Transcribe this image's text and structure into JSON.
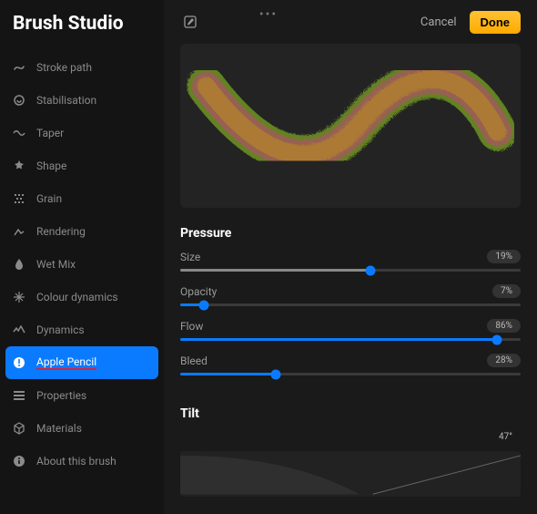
{
  "app_title": "Brush Studio",
  "topbar": {
    "cancel_label": "Cancel",
    "done_label": "Done"
  },
  "sidebar": {
    "items": [
      {
        "label": "Stroke path"
      },
      {
        "label": "Stabilisation"
      },
      {
        "label": "Taper"
      },
      {
        "label": "Shape"
      },
      {
        "label": "Grain"
      },
      {
        "label": "Rendering"
      },
      {
        "label": "Wet Mix"
      },
      {
        "label": "Colour dynamics"
      },
      {
        "label": "Dynamics"
      },
      {
        "label": "Apple Pencil"
      },
      {
        "label": "Properties"
      },
      {
        "label": "Materials"
      },
      {
        "label": "About this brush"
      }
    ]
  },
  "sections": {
    "pressure_title": "Pressure",
    "tilt_title": "Tilt"
  },
  "pressure": {
    "size": {
      "label": "Size",
      "value_text": "19%",
      "percent": 56
    },
    "opacity": {
      "label": "Opacity",
      "value_text": "7%",
      "percent": 7
    },
    "flow": {
      "label": "Flow",
      "value_text": "86%",
      "percent": 93
    },
    "bleed": {
      "label": "Bleed",
      "value_text": "28%",
      "percent": 28
    }
  },
  "tilt": {
    "value_text": "47°"
  }
}
